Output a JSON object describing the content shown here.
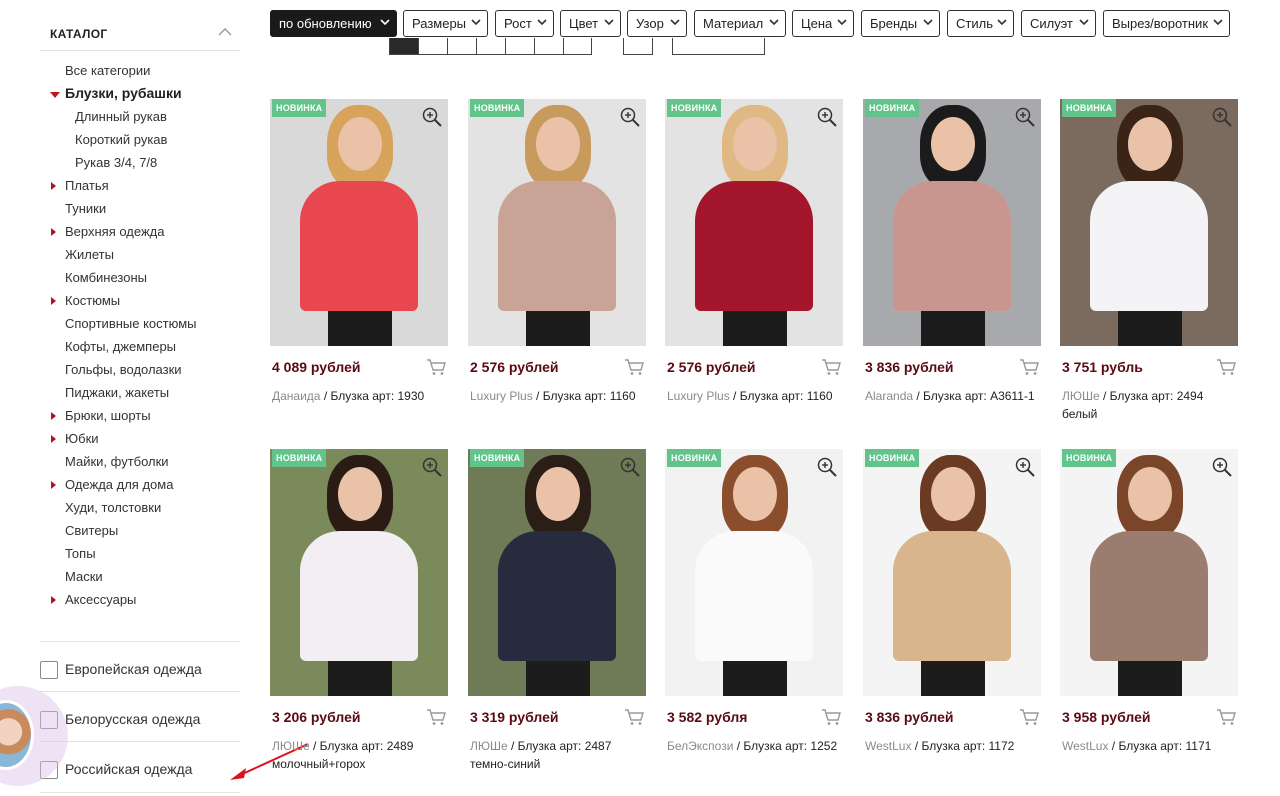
{
  "sidebar": {
    "title": "КАТАЛОГ",
    "categories": [
      {
        "label": "Все категории",
        "kind": "plain"
      },
      {
        "label": "Блузки, рубашки",
        "kind": "active"
      },
      {
        "label": "Длинный рукав",
        "kind": "sub"
      },
      {
        "label": "Короткий рукав",
        "kind": "sub"
      },
      {
        "label": "Рукав 3/4, 7/8",
        "kind": "sub"
      },
      {
        "label": "Платья",
        "kind": "arrow"
      },
      {
        "label": "Туники",
        "kind": "plain"
      },
      {
        "label": "Верхняя одежда",
        "kind": "arrow"
      },
      {
        "label": "Жилеты",
        "kind": "plain"
      },
      {
        "label": "Комбинезоны",
        "kind": "plain"
      },
      {
        "label": "Костюмы",
        "kind": "arrow"
      },
      {
        "label": "Спортивные костюмы",
        "kind": "plain"
      },
      {
        "label": "Кофты, джемперы",
        "kind": "plain"
      },
      {
        "label": "Гольфы, водолазки",
        "kind": "plain"
      },
      {
        "label": "Пиджаки, жакеты",
        "kind": "plain"
      },
      {
        "label": "Брюки, шорты",
        "kind": "arrow"
      },
      {
        "label": "Юбки",
        "kind": "arrow"
      },
      {
        "label": "Майки, футболки",
        "kind": "plain"
      },
      {
        "label": "Одежда для дома",
        "kind": "arrow"
      },
      {
        "label": "Худи, толстовки",
        "kind": "plain"
      },
      {
        "label": "Свитеры",
        "kind": "plain"
      },
      {
        "label": "Топы",
        "kind": "plain"
      },
      {
        "label": "Маски",
        "kind": "plain"
      },
      {
        "label": "Аксессуары",
        "kind": "arrow"
      }
    ],
    "filters": [
      "Европейская одежда",
      "Белорусская одежда",
      "Российская одежда"
    ]
  },
  "toolbar": {
    "sort_label": "по обновлению",
    "filters": [
      "Размеры",
      "Рост",
      "Цвет",
      "Узор",
      "Материал",
      "Цена",
      "Бренды",
      "Стиль",
      "Силуэт",
      "Вырез/воротник"
    ]
  },
  "products": [
    {
      "badge": "НОВИНКА",
      "price": "4 089 рублей",
      "brand": "Данаида",
      "title": " / Блузка арт: 1930",
      "top_color": "#e8474f",
      "bg_color": "#d9d9d9"
    },
    {
      "badge": "НОВИНКА",
      "price": "2 576 рублей",
      "brand": "Luxury Plus",
      "title": " / Блузка арт: 1160",
      "top_color": "#c9a395",
      "bg_color": "#e3e3e3"
    },
    {
      "badge": "НОВИНКА",
      "price": "2 576 рублей",
      "brand": "Luxury Plus",
      "title": " / Блузка арт: 1160",
      "top_color": "#a3162c",
      "bg_color": "#e3e3e3"
    },
    {
      "badge": "НОВИНКА",
      "price": "3 836 рублей",
      "brand": "Alaranda",
      "title": " / Блузка арт: А3611-1",
      "top_color": "#c9968f",
      "bg_color": "#a8a9ad"
    },
    {
      "badge": "НОВИНКА",
      "price": "3 751 рубль",
      "brand": "ЛЮШе",
      "title": " / Блузка арт: 2494 белый",
      "top_color": "#f4f4f6",
      "bg_color": "#7b6a5e"
    },
    {
      "badge": "НОВИНКА",
      "price": "3 206 рублей",
      "brand": "ЛЮШе",
      "title": " / Блузка арт: 2489 молочный+горох",
      "top_color": "#f3eef2",
      "bg_color": "#7a8a5a"
    },
    {
      "badge": "НОВИНКА",
      "price": "3 319 рублей",
      "brand": "ЛЮШе",
      "title": " / Блузка арт: 2487 темно-синий",
      "top_color": "#262b3e",
      "bg_color": "#6f7a56"
    },
    {
      "badge": "НОВИНКА",
      "price": "3 582 рубля",
      "brand": "БелЭкспози",
      "title": " / Блузка арт: 1252",
      "top_color": "#fafafa",
      "bg_color": "#f2f2f2"
    },
    {
      "badge": "НОВИНКА",
      "price": "3 836 рублей",
      "brand": "WestLux",
      "title": " / Блузка арт: 1172",
      "top_color": "#d8b58c",
      "bg_color": "#f4f4f4"
    },
    {
      "badge": "НОВИНКА",
      "price": "3 958 рублей",
      "brand": "WestLux",
      "title": " / Блузка арт: 1171",
      "top_color": "#9a7d6e",
      "bg_color": "#f4f4f4"
    }
  ],
  "icons": {
    "zoom": "magnifier-plus-icon",
    "cart": "cart-icon",
    "toggle": "chevron-up-icon"
  },
  "colors": {
    "price": "#5a0a12",
    "badge": "#62c48b",
    "arrow_marker": "#c0161f",
    "brand": "#8a8a8a"
  }
}
